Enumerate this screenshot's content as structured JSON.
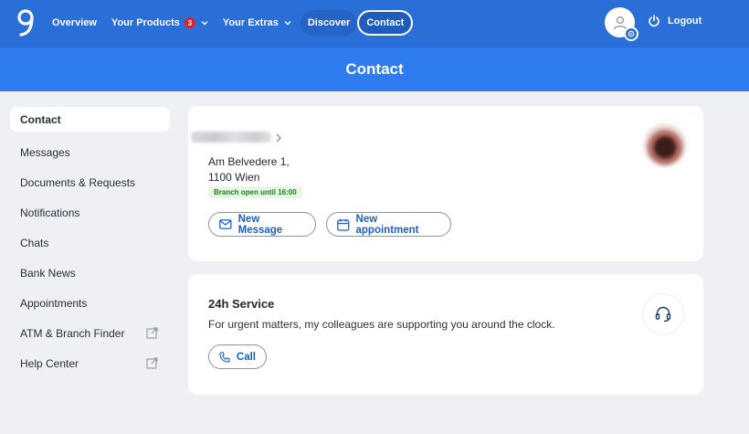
{
  "nav": {
    "items": [
      {
        "label": "Overview"
      },
      {
        "label": "Your Products",
        "badge": "3"
      },
      {
        "label": "Your Extras"
      },
      {
        "label": "Discover"
      },
      {
        "label": "Contact"
      }
    ],
    "logout_label": "Logout"
  },
  "page": {
    "title": "Contact"
  },
  "sidebar": {
    "items": [
      {
        "label": "Contact"
      },
      {
        "label": "Messages"
      },
      {
        "label": "Documents & Requests"
      },
      {
        "label": "Notifications"
      },
      {
        "label": "Chats"
      },
      {
        "label": "Bank News"
      },
      {
        "label": "Appointments"
      },
      {
        "label": "ATM & Branch Finder"
      },
      {
        "label": "Help Center"
      }
    ]
  },
  "branch_card": {
    "address_line1": "Am Belvedere 1,",
    "address_line2": "1100 Wien",
    "status": "Branch open until 16:00",
    "new_message_label": "New Message",
    "new_appointment_label": "New appointment"
  },
  "service_card": {
    "title": "24h Service",
    "text": "For urgent matters, my colleagues are supporting you around the clock.",
    "call_label": "Call"
  },
  "colors": {
    "nav_bg": "#2a6ed7",
    "title_band": "#2f7cf0",
    "accent": "#1d5fc2",
    "badge": "#d8262e",
    "status_green": "#237a1f"
  }
}
